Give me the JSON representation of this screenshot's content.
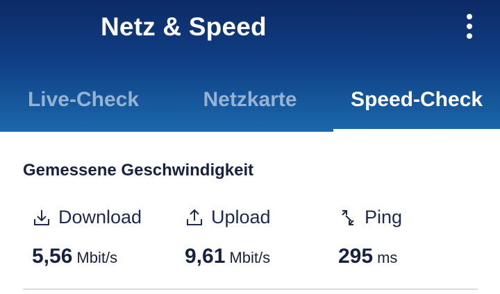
{
  "appbar": {
    "title": "Netz & Speed",
    "overflow_icon": "more-vert-icon"
  },
  "tabs": [
    {
      "label": "Live-Check",
      "active": false
    },
    {
      "label": "Netzkarte",
      "active": false
    },
    {
      "label": "Speed-Check",
      "active": true
    }
  ],
  "section": {
    "title": "Gemessene Geschwindigkeit"
  },
  "metrics": [
    {
      "label": "Download",
      "icon": "download-icon",
      "value": "5,56",
      "unit": "Mbit/s"
    },
    {
      "label": "Upload",
      "icon": "upload-icon",
      "value": "9,61",
      "unit": "Mbit/s"
    },
    {
      "label": "Ping",
      "icon": "ping-icon",
      "value": "295",
      "unit": "ms"
    }
  ],
  "colors": {
    "header_top": "#0c2a66",
    "header_bottom": "#1a68ab",
    "text_dark": "#16223f"
  }
}
